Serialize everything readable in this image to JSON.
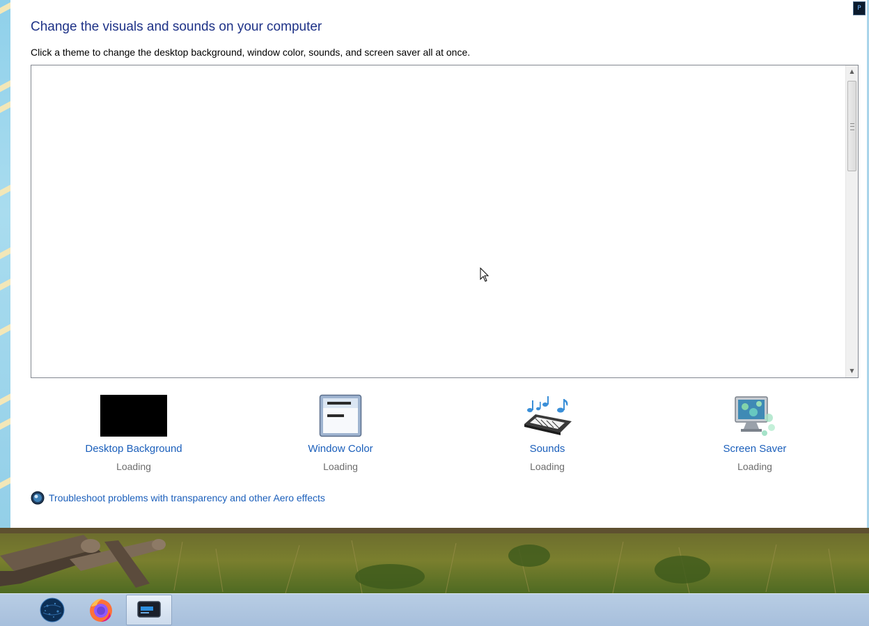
{
  "window": {
    "title": "Change the visuals and sounds on your computer",
    "subtitle": "Click a theme to change the desktop background, window color, sounds, and screen saver all at once."
  },
  "theme_list": {
    "items": [],
    "scrollbar": {
      "up_icon": "scroll-up-arrow",
      "down_icon": "scroll-down-arrow"
    }
  },
  "settings": [
    {
      "label": "Desktop Background",
      "status": "Loading",
      "icon": "desktop-background-icon"
    },
    {
      "label": "Window Color",
      "status": "Loading",
      "icon": "window-color-icon"
    },
    {
      "label": "Sounds",
      "status": "Loading",
      "icon": "sounds-icon"
    },
    {
      "label": "Screen Saver",
      "status": "Loading",
      "icon": "screen-saver-icon"
    }
  ],
  "troubleshoot": {
    "label": "Troubleshoot problems with transparency and other Aero effects",
    "icon": "troubleshoot-icon"
  },
  "taskbar": {
    "items": [
      {
        "name": "media-player",
        "icon": "media-player-icon"
      },
      {
        "name": "globe-browser",
        "icon": "globe-icon"
      },
      {
        "name": "firefox",
        "icon": "firefox-icon"
      },
      {
        "name": "personalization",
        "icon": "personalization-window-icon",
        "active": true
      }
    ]
  },
  "colors": {
    "title": "#1e3287",
    "link": "#1b5fbb",
    "status": "#6d6d6d",
    "taskbar": "#a7bfdc"
  }
}
